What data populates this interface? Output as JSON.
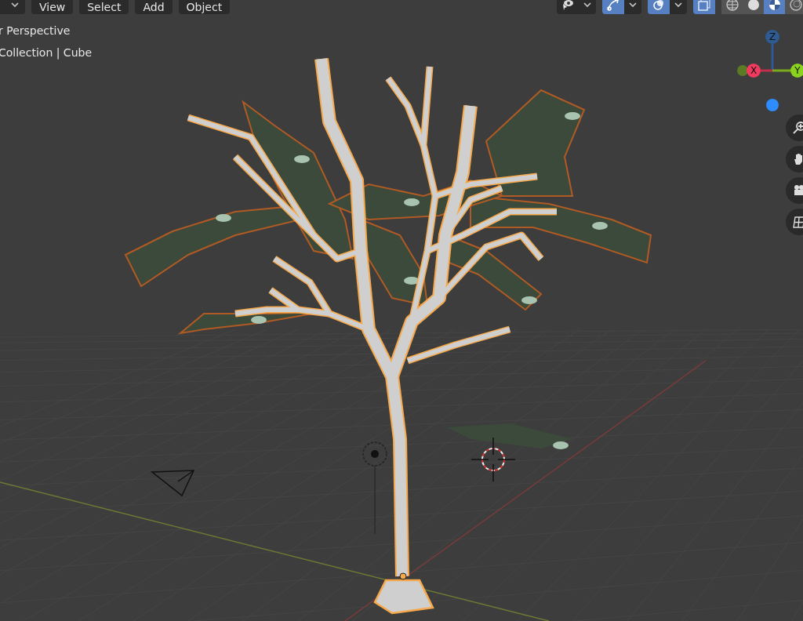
{
  "header": {
    "mode_menu_open": false,
    "menus": [
      {
        "label": "View"
      },
      {
        "label": "Select"
      },
      {
        "label": "Add"
      },
      {
        "label": "Object"
      }
    ],
    "toggles": [
      {
        "kind": "visibility",
        "on": false
      },
      {
        "kind": "gizmo",
        "on": true
      },
      {
        "kind": "overlay",
        "on": true
      },
      {
        "kind": "xray",
        "on": true
      }
    ],
    "shading": [
      {
        "kind": "wireframe",
        "selected": false
      },
      {
        "kind": "solid",
        "selected": false
      },
      {
        "kind": "material",
        "selected": true
      },
      {
        "kind": "rendered",
        "selected": false
      }
    ]
  },
  "overlay_text": {
    "view": "r Perspective",
    "object": "Collection | Cube"
  },
  "gizmo": {
    "z": "Z",
    "x": "X",
    "y": "Y"
  },
  "nav_tools": [
    {
      "kind": "zoom"
    },
    {
      "kind": "pan"
    },
    {
      "kind": "camera"
    },
    {
      "kind": "ortho"
    }
  ]
}
